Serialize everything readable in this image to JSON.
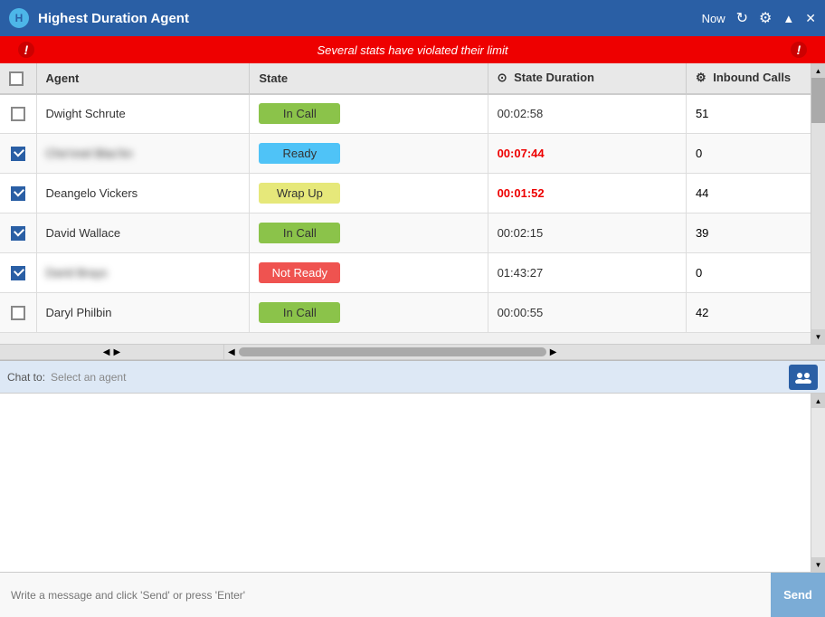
{
  "titleBar": {
    "icon": "H",
    "title": "Highest Duration Agent",
    "nowLabel": "Now",
    "refreshIcon": "↻",
    "settingsIcon": "⚙",
    "minimizeIcon": "▲",
    "closeIcon": "✕"
  },
  "alertBar": {
    "message": "Several stats have violated their limit",
    "leftIcon": "!",
    "rightIcon": "!"
  },
  "table": {
    "columns": [
      {
        "key": "check",
        "label": ""
      },
      {
        "key": "agent",
        "label": "Agent"
      },
      {
        "key": "state",
        "label": "State"
      },
      {
        "key": "duration",
        "label": "State Duration",
        "icon": "⊙"
      },
      {
        "key": "inbound",
        "label": "Inbound Calls",
        "icon": "⚙"
      }
    ],
    "rows": [
      {
        "checked": false,
        "agent": "Dwight Schrute",
        "blurred": false,
        "state": "In Call",
        "stateClass": "state-incall",
        "duration": "00:02:58",
        "durationAlert": false,
        "inbound": "51"
      },
      {
        "checked": true,
        "agent": "Che'nnel Blac'kn",
        "blurred": true,
        "state": "Ready",
        "stateClass": "state-ready",
        "duration": "00:07:44",
        "durationAlert": true,
        "inbound": "0"
      },
      {
        "checked": true,
        "agent": "Deangelo Vickers",
        "blurred": false,
        "state": "Wrap Up",
        "stateClass": "state-wrapup",
        "duration": "00:01:52",
        "durationAlert": true,
        "inbound": "44"
      },
      {
        "checked": true,
        "agent": "David Wallace",
        "blurred": false,
        "state": "In Call",
        "stateClass": "state-incall",
        "duration": "00:02:15",
        "durationAlert": false,
        "inbound": "39"
      },
      {
        "checked": true,
        "agent": "Darid Brays",
        "blurred": true,
        "state": "Not Ready",
        "stateClass": "state-notready",
        "duration": "01:43:27",
        "durationAlert": false,
        "inbound": "0"
      },
      {
        "checked": false,
        "agent": "Daryl Philbin",
        "blurred": false,
        "state": "In Call",
        "stateClass": "state-incall",
        "duration": "00:00:55",
        "durationAlert": false,
        "inbound": "42"
      }
    ]
  },
  "chat": {
    "toLabel": "Chat to:",
    "selectPlaceholder": "Select an agent",
    "inputPlaceholder": "Write a message and click 'Send' or press 'Enter'",
    "sendLabel": "Send"
  },
  "colors": {
    "titleBg": "#2a5fa5",
    "alertBg": "#dd0000",
    "stateIncall": "#8bc34a",
    "stateReady": "#4fc3f7",
    "stateWrapup": "#e6e87a",
    "stateNotReady": "#ef5350",
    "durationAlert": "#ee0000",
    "chatBarBg": "#dde8f5",
    "sendBtnBg": "#7bacd6"
  }
}
